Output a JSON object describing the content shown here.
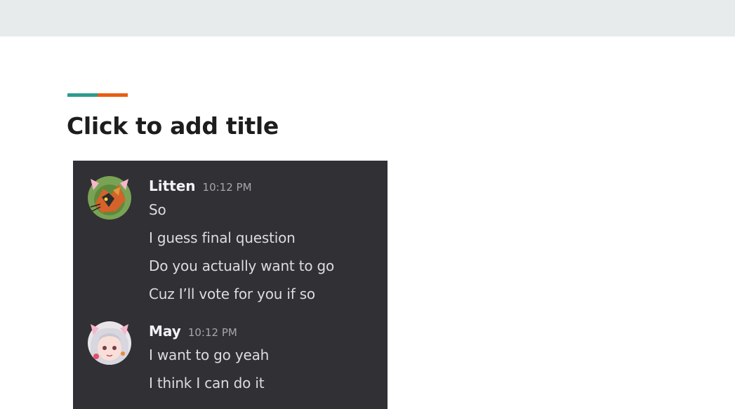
{
  "slide": {
    "title": "Click to add title",
    "accent_colors": [
      "#2a9d8f",
      "#e85d12"
    ]
  },
  "chat": {
    "messages": [
      {
        "author": "Litten",
        "time": "10:12 PM",
        "avatar_icon": "litten-cat-avatar-icon",
        "lines": [
          "So",
          "I guess final question",
          "Do you actually want to go",
          "Cuz I’ll vote for you if so"
        ]
      },
      {
        "author": "May",
        "time": "10:12 PM",
        "avatar_icon": "anime-girl-cat-ears-avatar-icon",
        "lines": [
          "I want to go yeah",
          "I think I can do it"
        ]
      }
    ]
  }
}
